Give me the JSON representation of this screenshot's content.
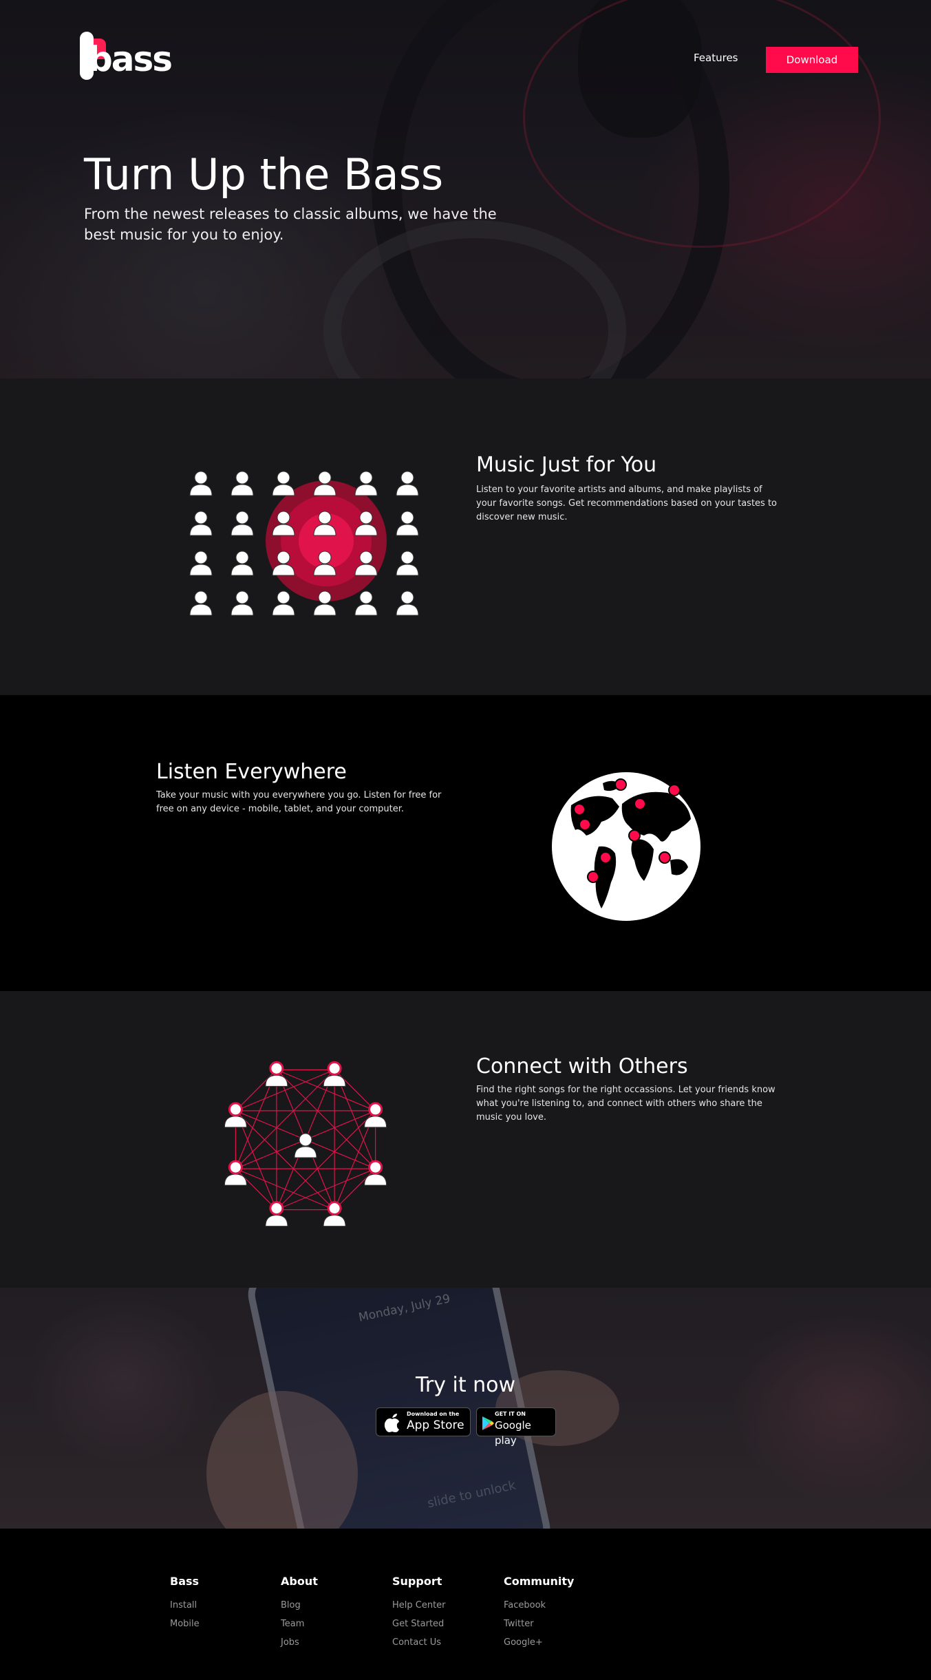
{
  "header": {
    "logo_text": "bass",
    "nav_features": "Features",
    "download_label": "Download"
  },
  "hero": {
    "title": "Turn Up the Bass",
    "subtitle": "From the newest releases to classic albums, we have the best music for you to enjoy."
  },
  "features": [
    {
      "title": "Music Just for You",
      "text": "Listen to your favorite artists and albums, and make playlists of your favorite songs. Get recommendations based on your tastes to discover new music."
    },
    {
      "title": "Listen Everywhere",
      "text": "Take your music with you everywhere you go. Listen for free for free on any device - mobile, tablet, and your computer."
    },
    {
      "title": "Connect with Others",
      "text": "Find the right songs for the right occassions. Let your friends know what you're listening to, and connect with others who share the music you love."
    }
  ],
  "cta": {
    "title": "Try it now",
    "phone_date": "Monday, July 29",
    "phone_unlock": "slide to unlock",
    "app_store": {
      "small": "Download on the",
      "big": "App Store"
    },
    "google_play": {
      "small": "GET IT ON",
      "big": "Google play"
    }
  },
  "footer": {
    "columns": [
      {
        "heading": "Bass",
        "links": [
          "Install",
          "Mobile"
        ]
      },
      {
        "heading": "About",
        "links": [
          "Blog",
          "Team",
          "Jobs"
        ]
      },
      {
        "heading": "Support",
        "links": [
          "Help Center",
          "Get Started",
          "Contact Us"
        ]
      },
      {
        "heading": "Community",
        "links": [
          "Facebook",
          "Twitter",
          "Google+"
        ]
      }
    ]
  },
  "colors": {
    "accent": "#ff0a4b",
    "dark_section": "#18181a",
    "black_section": "#000000"
  }
}
